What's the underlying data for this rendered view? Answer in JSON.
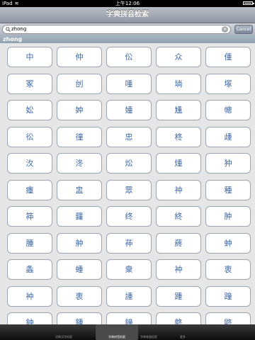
{
  "status_bar": {
    "device": "iPad",
    "time": "上午12:06"
  },
  "nav": {
    "title": "字典拼音检索"
  },
  "search": {
    "value": "zhong",
    "cancel_label": "Cancel"
  },
  "section": {
    "header": "zhong"
  },
  "grid": {
    "rows": [
      [
        "中",
        "仲",
        "伀",
        "众",
        "偅"
      ],
      [
        "冢",
        "刣",
        "喠",
        "埫",
        "塚"
      ],
      [
        "妐",
        "妕",
        "媑",
        "尰",
        "幒"
      ],
      [
        "彸",
        "徸",
        "忠",
        "柊",
        "歱"
      ],
      [
        "汷",
        "泈",
        "炂",
        "煄",
        "狆"
      ],
      [
        "瘇",
        "盅",
        "眾",
        "祌",
        "種"
      ],
      [
        "筗",
        "籦",
        "终",
        "終",
        "肿"
      ],
      [
        "腫",
        "舯",
        "茽",
        "蔠",
        "蚛"
      ],
      [
        "螽",
        "蝩",
        "衆",
        "衶",
        "衷"
      ],
      [
        "衶",
        "衷",
        "諥",
        "踵",
        "蹱"
      ],
      [
        "鈡",
        "鍾",
        "鐘",
        "鴤",
        "鼨"
      ]
    ]
  },
  "tabs": [
    {
      "label": "词典汉字检索",
      "selected": false
    },
    {
      "label": "字典拼音检索",
      "selected": true
    },
    {
      "label": "字典笔画检索",
      "selected": false
    },
    {
      "label": "更多",
      "selected": false
    }
  ]
}
